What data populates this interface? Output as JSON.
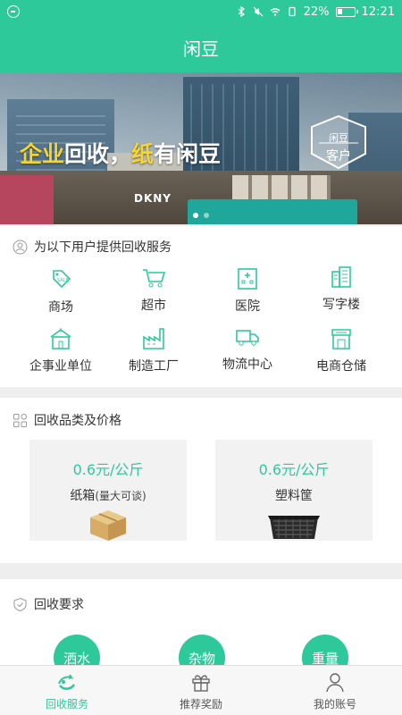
{
  "status_bar": {
    "battery": "22%",
    "time": "12:21"
  },
  "header": {
    "title": "闲豆"
  },
  "banner": {
    "slogan_part1": "企业",
    "slogan_part2": "回收，",
    "slogan_part3": "纸",
    "slogan_part4": "有闲豆",
    "badge_top": "闲豆",
    "badge_bottom": "客户",
    "store_sign": "DKNY",
    "slide_count": 2,
    "active_slide": 0
  },
  "service_section": {
    "title": "为以下用户提供回收服务",
    "categories": [
      {
        "label": "商场",
        "icon": "sale-tag-icon"
      },
      {
        "label": "超市",
        "icon": "shopping-cart-icon"
      },
      {
        "label": "医院",
        "icon": "hospital-icon"
      },
      {
        "label": "写字楼",
        "icon": "office-building-icon"
      },
      {
        "label": "企事业单位",
        "icon": "institution-icon"
      },
      {
        "label": "制造工厂",
        "icon": "factory-icon"
      },
      {
        "label": "物流中心",
        "icon": "truck-icon"
      },
      {
        "label": "电商仓储",
        "icon": "warehouse-icon"
      }
    ]
  },
  "price_section": {
    "title": "回收品类及价格",
    "items": [
      {
        "price": "0.6元/公斤",
        "name": "纸箱",
        "note": "(量大可谈)",
        "image": "cardboard-box"
      },
      {
        "price": "0.6元/公斤",
        "name": "塑料筐",
        "note": "",
        "image": "plastic-crate"
      }
    ]
  },
  "requirements_section": {
    "title": "回收要求",
    "items": [
      "洒水",
      "杂物",
      "重量"
    ]
  },
  "tabbar": {
    "tabs": [
      {
        "label": "回收服务",
        "icon": "recycle-service-icon",
        "active": true
      },
      {
        "label": "推荐奖励",
        "icon": "gift-icon",
        "active": false
      },
      {
        "label": "我的账号",
        "icon": "user-icon",
        "active": false
      }
    ]
  },
  "colors": {
    "brand": "#2ec99b",
    "slogan_highlight": "#f6d531"
  }
}
